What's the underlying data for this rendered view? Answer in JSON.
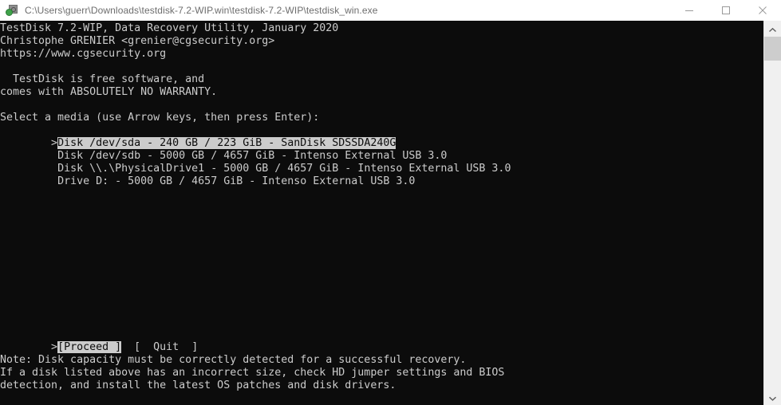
{
  "window": {
    "title": "C:\\Users\\guerr\\Downloads\\testdisk-7.2-WIP.win\\testdisk-7.2-WIP\\testdisk_win.exe",
    "icon": "console-app-icon",
    "controls": {
      "minimize": "minimize-icon",
      "maximize": "maximize-icon",
      "close": "close-icon"
    }
  },
  "colors": {
    "console_background": "#0c0c0c",
    "console_foreground": "#cccccc",
    "titlebar_background": "#ffffff",
    "titlebar_text": "#6d6d6d",
    "selection_background": "#cccccc",
    "selection_foreground": "#0c0c0c",
    "scrollbar_track": "#f0f0f0",
    "scrollbar_thumb": "#cdcdcd"
  },
  "console": {
    "header": {
      "line1": "TestDisk 7.2-WIP, Data Recovery Utility, January 2020",
      "line2": "Christophe GRENIER <grenier@cgsecurity.org>",
      "line3": "https://www.cgsecurity.org"
    },
    "license": {
      "line1": "  TestDisk is free software, and",
      "line2": "comes with ABSOLUTELY NO WARRANTY."
    },
    "prompt": "Select a media (use Arrow keys, then press Enter):",
    "media": [
      {
        "cursor": ">",
        "text": "Disk /dev/sda - 240 GB / 223 GiB - SanDisk SDSSDA240G",
        "selected": true
      },
      {
        "cursor": " ",
        "text": "Disk /dev/sdb - 5000 GB / 4657 GiB - Intenso External USB 3.0",
        "selected": false
      },
      {
        "cursor": " ",
        "text": "Disk \\\\.\\PhysicalDrive1 - 5000 GB / 4657 GiB - Intenso External USB 3.0",
        "selected": false
      },
      {
        "cursor": " ",
        "text": "Drive D: - 5000 GB / 4657 GiB - Intenso External USB 3.0",
        "selected": false
      }
    ],
    "buttons": {
      "cursor": ">",
      "proceed": "[Proceed ]",
      "gap": "  ",
      "quit": "[  Quit  ]"
    },
    "note": {
      "line1": "Note: Disk capacity must be correctly detected for a successful recovery.",
      "line2": "If a disk listed above has an incorrect size, check HD jumper settings and BIOS",
      "line3": "detection, and install the latest OS patches and disk drivers."
    }
  },
  "scrollbar": {
    "up_arrow": "chevron-up-icon",
    "down_arrow": "chevron-down-icon",
    "thumb": "scrollbar-thumb"
  }
}
